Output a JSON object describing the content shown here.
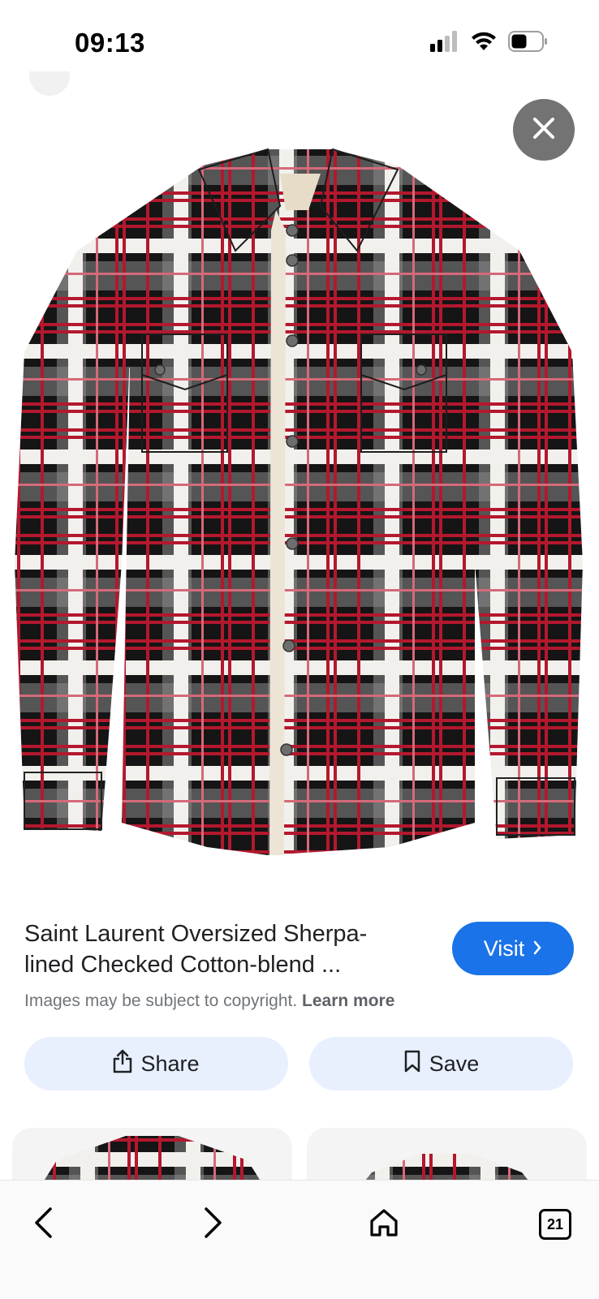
{
  "status_bar": {
    "time": "09:13",
    "icons": [
      "cellular-signal-icon",
      "wifi-icon",
      "battery-icon"
    ]
  },
  "viewer": {
    "image_alt": "Red, black and white plaid sherpa-lined shirt jacket",
    "close_icon": "close-icon"
  },
  "result": {
    "title": "Saint Laurent Oversized Sherpa-lined Checked Cotton-blend ...",
    "copyright_text": "Images may be subject to copyright.",
    "learn_more": "Learn more",
    "visit_label": "Visit"
  },
  "actions": {
    "share_label": "Share",
    "save_label": "Save"
  },
  "nav": {
    "tab_count": "21"
  },
  "colors": {
    "accent": "#1a73e8",
    "action_bg": "#e8f0fe",
    "plaid_red": "#b3182e",
    "plaid_black": "#151515",
    "plaid_white": "#f2f0ec"
  }
}
